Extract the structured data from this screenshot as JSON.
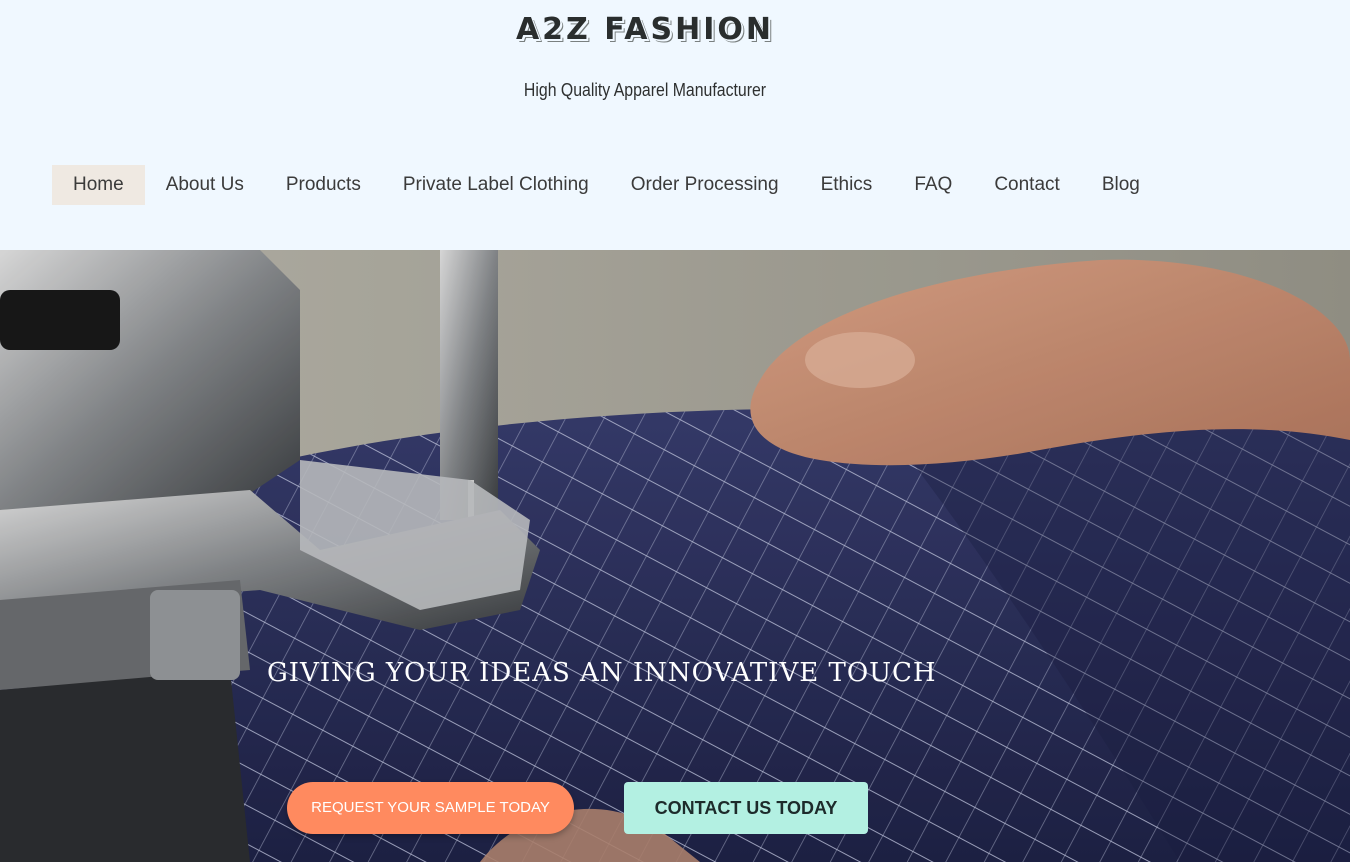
{
  "header": {
    "brand": "A2Z FASHION",
    "tagline": "High Quality Apparel Manufacturer"
  },
  "nav": {
    "items": [
      {
        "label": "Home",
        "active": true
      },
      {
        "label": "About Us"
      },
      {
        "label": "Products"
      },
      {
        "label": "Private Label Clothing"
      },
      {
        "label": "Order Processing"
      },
      {
        "label": "Ethics"
      },
      {
        "label": "FAQ"
      },
      {
        "label": "Contact"
      },
      {
        "label": "Blog"
      }
    ]
  },
  "hero": {
    "headline": "GIVING YOUR IDEAS AN INNOVATIVE TOUCH",
    "sample_button": "REQUEST YOUR SAMPLE TODAY",
    "contact_button": "CONTACT US TODAY"
  },
  "colors": {
    "page_background": "#f0f8ff",
    "nav_active_background": "#efe9e2",
    "sample_button": "#ff8a5f",
    "contact_button": "#b3f0e2",
    "fabric": "#2a2f5a"
  }
}
